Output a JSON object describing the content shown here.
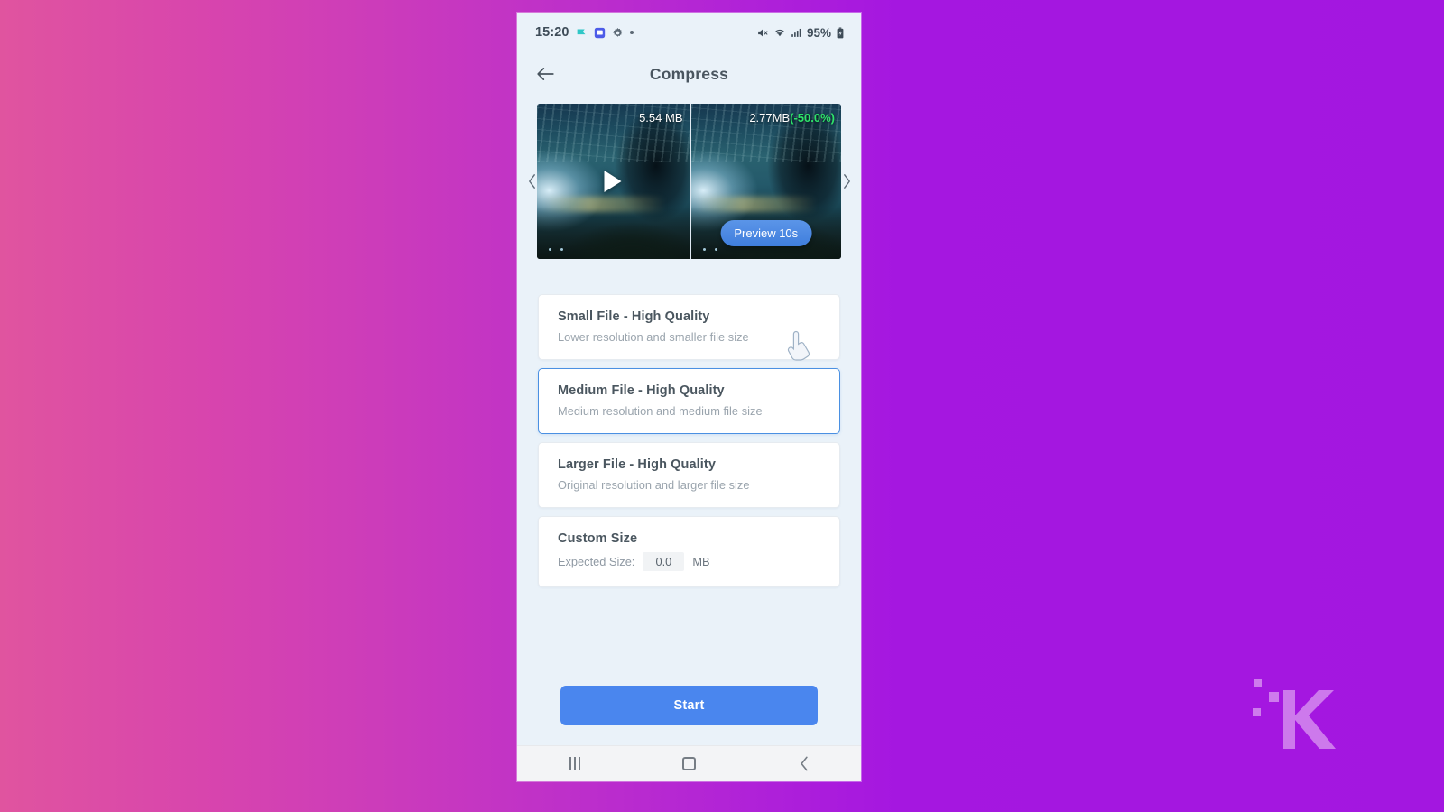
{
  "status_bar": {
    "time": "15:20",
    "left_icons": [
      "flag-icon",
      "screenshot-icon",
      "gear-icon",
      "dot-icon"
    ],
    "right_icons": [
      "mute-icon",
      "wifi-icon",
      "signal-icon"
    ],
    "battery_percent": "95%",
    "battery_icon": "battery-icon"
  },
  "app_bar": {
    "back_icon": "back-arrow-icon",
    "title": "Compress"
  },
  "carousel": {
    "prev_icon": "chevron-left-icon",
    "next_icon": "chevron-right-icon",
    "original": {
      "size_label": "5.54 MB",
      "play_icon": "play-icon"
    },
    "compressed": {
      "size_label": "2.77MB",
      "reduction_label": "(-50.0%)",
      "preview_button": "Preview 10s"
    },
    "cursor_icon": "hand-pointer-icon"
  },
  "options": [
    {
      "title": "Small File - High Quality",
      "subtitle": "Lower resolution and smaller file size",
      "selected": false
    },
    {
      "title": "Medium File - High Quality",
      "subtitle": "Medium resolution and medium file size",
      "selected": true
    },
    {
      "title": "Larger File - High Quality",
      "subtitle": "Original resolution and larger file size",
      "selected": false
    }
  ],
  "custom_size": {
    "title": "Custom Size",
    "label": "Expected Size:",
    "value": "0.0",
    "placeholder": "0.0",
    "unit": "MB"
  },
  "actions": {
    "start_label": "Start"
  },
  "nav_bar": {
    "recents_icon": "recents-icon",
    "home_icon": "home-icon",
    "back_icon": "nav-back-icon"
  },
  "colors": {
    "accent_blue": "#4a86ee",
    "selected_border": "#4a90e2",
    "reduction_green": "#2ee36a",
    "backdrop_start": "#e0549f",
    "backdrop_end": "#a517e0",
    "screen_bg": "#eaf2f9"
  },
  "watermark": {
    "letter": "K"
  }
}
